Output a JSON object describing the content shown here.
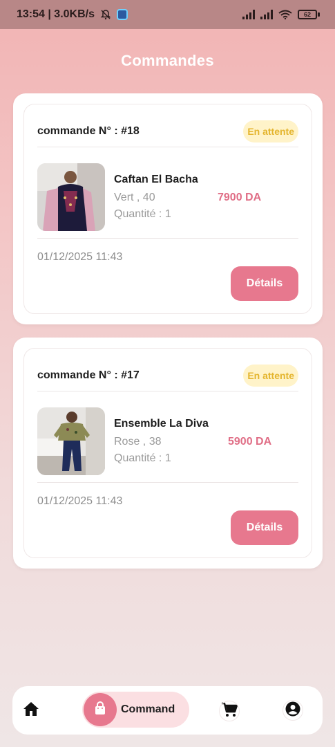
{
  "status_bar": {
    "time_speed": "13:54 | 3.0KB/s",
    "battery": "62"
  },
  "header": {
    "title": "Commandes"
  },
  "orders": [
    {
      "number": "commande N°  : #18",
      "status": "En attente",
      "product_name": "Caftan El Bacha",
      "variant": "Vert , 40",
      "quantity": "Quantité : 1",
      "price": "7900 DA",
      "date": "01/12/2025 11:43",
      "details_label": "Détails"
    },
    {
      "number": "commande N°  : #17",
      "status": "En attente",
      "product_name": "Ensemble La Diva",
      "variant": "Rose , 38",
      "quantity": "Quantité : 1",
      "price": "5900 DA",
      "date": "01/12/2025 11:43",
      "details_label": "Détails"
    }
  ],
  "bottom_nav": {
    "items": [
      {
        "icon": "home-icon"
      },
      {
        "icon": "shopping-bag-icon",
        "label": "Command",
        "active": true
      },
      {
        "icon": "cart-icon"
      },
      {
        "icon": "account-icon"
      }
    ]
  },
  "colors": {
    "accent": "#e7788e",
    "price": "#e06e86",
    "status_bg": "#fff3c9",
    "status_text": "#e4b52f"
  }
}
